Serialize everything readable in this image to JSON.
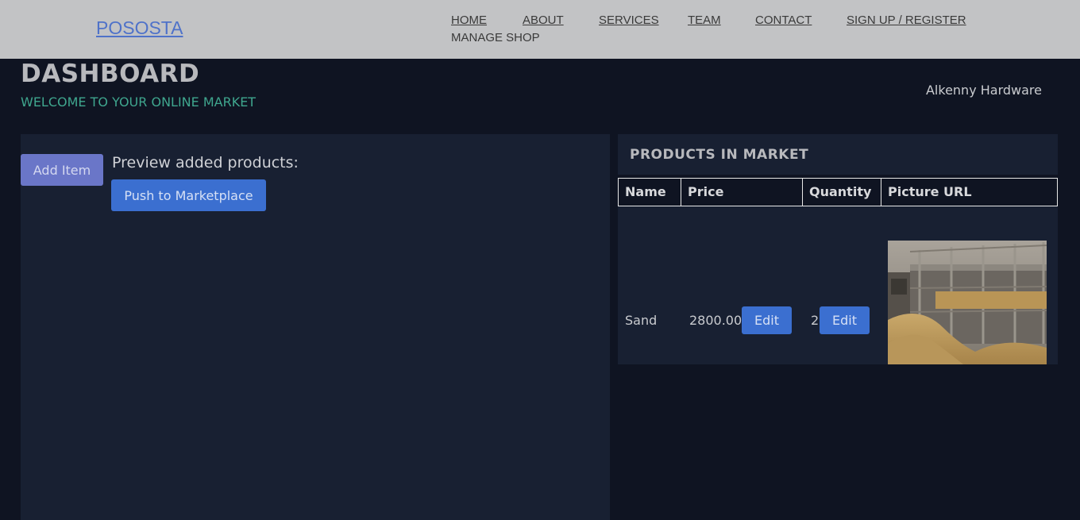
{
  "nav": {
    "brand": "POSOSTA",
    "links": [
      "HOME",
      "ABOUT",
      "SERVICES",
      "TEAM",
      "CONTACT",
      "SIGN UP / REGISTER"
    ],
    "manage": "MANAGE SHOP"
  },
  "header": {
    "title": "DASHBOARD",
    "subtitle": "WELCOME TO YOUR ONLINE MARKET",
    "shop_name": "Alkenny Hardware"
  },
  "left": {
    "add_label": "Add Item",
    "preview_label": "Preview added products:",
    "push_label": "Push to Marketplace"
  },
  "market": {
    "title": "PRODUCTS IN MARKET",
    "columns": [
      "Name",
      "Price",
      "Quantity",
      "Picture URL"
    ],
    "rows": [
      {
        "name": "Sand",
        "price": "2800.00",
        "quantity": "2",
        "edit_label": "Edit"
      }
    ]
  },
  "colors": {
    "nav_bg": "#c2c3c5",
    "brand": "#4f72c9",
    "page_bg": "#0f1422",
    "panel_bg": "#182032",
    "accent_green": "#3fa68e",
    "button_blue": "#3b6fd0",
    "button_purple": "#6a76c8"
  }
}
